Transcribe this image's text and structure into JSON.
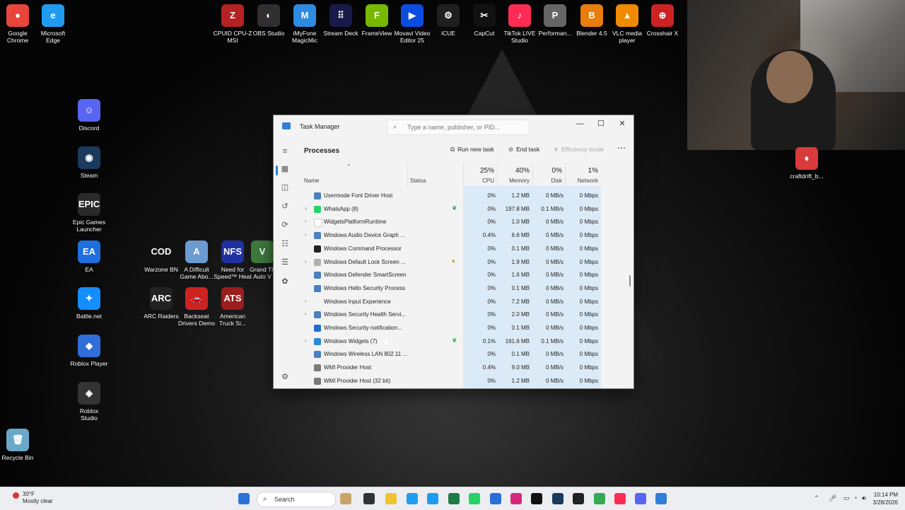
{
  "desktop": {
    "icons_left": [
      {
        "label": "Google\nChrome",
        "glyph": "●",
        "color": "#e8453c"
      },
      {
        "label": "Microsoft\nEdge",
        "glyph": "e",
        "color": "#1f9cf0"
      },
      {
        "label": "Discord",
        "glyph": "☺",
        "color": "#5865f2"
      },
      {
        "label": "Steam",
        "glyph": "◉",
        "color": "#1b3a5c"
      },
      {
        "label": "Epic Games\nLauncher",
        "glyph": "EPIC",
        "color": "#2a2a2a"
      },
      {
        "label": "EA",
        "glyph": "EA",
        "color": "#1f6fe0"
      },
      {
        "label": "Battle.net",
        "glyph": "✦",
        "color": "#148eff"
      },
      {
        "label": "Roblox Player",
        "glyph": "◆",
        "color": "#2f6ed8"
      },
      {
        "label": "Roblox\nStudio",
        "glyph": "◈",
        "color": "#333"
      },
      {
        "label": "Recycle Bin",
        "glyph": "🗑",
        "color": "#6aa8c8"
      }
    ],
    "icons_games": [
      {
        "label": "Warzone BN",
        "glyph": "COD",
        "color": "#111"
      },
      {
        "label": "A Difficult\nGame Abo...",
        "glyph": "A",
        "color": "#6b9bd1"
      },
      {
        "label": "Need for\nSpeed™ Heat",
        "glyph": "NFS",
        "color": "#2030a0"
      },
      {
        "label": "Grand Th\nAuto V",
        "glyph": "V",
        "color": "#3d7a3d"
      },
      {
        "label": "ARC Raiders",
        "glyph": "ARC",
        "color": "#222"
      },
      {
        "label": "Backseat\nDrivers Demo",
        "glyph": "🚗",
        "color": "#c22"
      },
      {
        "label": "American\nTruck Si...",
        "glyph": "ATS",
        "color": "#9b1d1d"
      }
    ],
    "icons_top": [
      {
        "label": "CPUID CPU-Z\nMSI",
        "glyph": "Z",
        "color": "#b42222"
      },
      {
        "label": "OBS Studio",
        "glyph": "◐",
        "color": "#302e31"
      },
      {
        "label": "iMyFone\nMagicMic",
        "glyph": "M",
        "color": "#2d8be0"
      },
      {
        "label": "Stream Deck",
        "glyph": "⠿",
        "color": "#1a1a4a"
      },
      {
        "label": "FrameView",
        "glyph": "F",
        "color": "#76b900"
      },
      {
        "label": "Movavi Video\nEditor 25",
        "glyph": "▶",
        "color": "#0a4de0"
      },
      {
        "label": "iCUE",
        "glyph": "⚙",
        "color": "#1f1f1f"
      },
      {
        "label": "CapCut",
        "glyph": "✂",
        "color": "#111"
      },
      {
        "label": "TikTok LIVE\nStudio",
        "glyph": "♪",
        "color": "#fe2c55"
      },
      {
        "label": "Performan...",
        "glyph": "P",
        "color": "#666"
      },
      {
        "label": "Blender 4.5",
        "glyph": "B",
        "color": "#e87d0d"
      },
      {
        "label": "VLC media\nplayer",
        "glyph": "▲",
        "color": "#f08a00"
      },
      {
        "label": "Crosshair X",
        "glyph": "⊕",
        "color": "#c22"
      }
    ],
    "file_icon": {
      "label": "craftdrift_b...",
      "glyph": "♦",
      "color": "#d93a3a"
    }
  },
  "task_manager": {
    "title": "Task Manager",
    "search_placeholder": "Type a name, publisher, or PID...",
    "heading": "Processes",
    "run_new_task": "Run new task",
    "end_task": "End task",
    "efficiency_mode": "Efficiency mode",
    "more": "⋯",
    "columns": {
      "name": "Name",
      "status": "Status",
      "cpu_pct": "25%",
      "cpu": "CPU",
      "mem_pct": "40%",
      "mem": "Memory",
      "disk_pct": "0%",
      "disk": "Disk",
      "net_pct": "1%",
      "net": "Network"
    },
    "rows": [
      {
        "expand": false,
        "name": "Usermode Font Driver Host",
        "status": "",
        "cpu": "0%",
        "mem": "1.2 MB",
        "disk": "0 MB/s",
        "net": "0 Mbps",
        "icon_color": "#4a7fc1"
      },
      {
        "expand": true,
        "name": "WhatsApp (8)",
        "status": "leaf",
        "cpu": "0%",
        "mem": "197.8 MB",
        "disk": "0.1 MB/s",
        "net": "0 Mbps",
        "icon_color": "#25d366"
      },
      {
        "expand": true,
        "name": "WidgetsPlatformRuntime",
        "status": "",
        "cpu": "0%",
        "mem": "1.0 MB",
        "disk": "0 MB/s",
        "net": "0 Mbps",
        "icon_color": "#ffffff"
      },
      {
        "expand": true,
        "name": "Windows Audio Device Graph ...",
        "status": "",
        "cpu": "0.4%",
        "mem": "6.6 MB",
        "disk": "0 MB/s",
        "net": "0 Mbps",
        "icon_color": "#4a7fc1"
      },
      {
        "expand": false,
        "name": "Windows Command Processor",
        "status": "",
        "cpu": "0%",
        "mem": "0.1 MB",
        "disk": "0 MB/s",
        "net": "0 Mbps",
        "icon_color": "#222222"
      },
      {
        "expand": true,
        "name": "Windows Default Lock Screen ...",
        "status": "pause",
        "cpu": "0%",
        "mem": "1.9 MB",
        "disk": "0 MB/s",
        "net": "0 Mbps",
        "icon_color": "#b0b0b0"
      },
      {
        "expand": false,
        "name": "Windows Defender SmartScreen",
        "status": "",
        "cpu": "0%",
        "mem": "1.6 MB",
        "disk": "0 MB/s",
        "net": "0 Mbps",
        "icon_color": "#4a7fc1"
      },
      {
        "expand": false,
        "name": "Windows Hello Security Process",
        "status": "",
        "cpu": "0%",
        "mem": "0.1 MB",
        "disk": "0 MB/s",
        "net": "0 Mbps",
        "icon_color": "#4a7fc1"
      },
      {
        "expand": true,
        "name": "Windows Input Experience",
        "status": "",
        "cpu": "0%",
        "mem": "7.2 MB",
        "disk": "0 MB/s",
        "net": "0 Mbps",
        "icon_color": ""
      },
      {
        "expand": true,
        "name": "Windows Security Health Servi...",
        "status": "",
        "cpu": "0%",
        "mem": "2.0 MB",
        "disk": "0 MB/s",
        "net": "0 Mbps",
        "icon_color": "#4a7fc1"
      },
      {
        "expand": false,
        "name": "Windows Security notification...",
        "status": "",
        "cpu": "0%",
        "mem": "0.1 MB",
        "disk": "0 MB/s",
        "net": "0 Mbps",
        "icon_color": "#1e6fd0"
      },
      {
        "expand": true,
        "name": "Windows Widgets (7)",
        "status": "leaf",
        "cpu": "0.1%",
        "mem": "161.6 MB",
        "disk": "0.1 MB/s",
        "net": "0 Mbps",
        "icon_color": "#2b8ad8"
      },
      {
        "expand": false,
        "name": "Windows Wireless LAN 802.11 ...",
        "status": "",
        "cpu": "0%",
        "mem": "0.1 MB",
        "disk": "0 MB/s",
        "net": "0 Mbps",
        "icon_color": "#4a7fc1"
      },
      {
        "expand": false,
        "name": "WMI Provider Host",
        "status": "",
        "cpu": "0.4%",
        "mem": "9.0 MB",
        "disk": "0 MB/s",
        "net": "0 Mbps",
        "icon_color": "#7a7a7a"
      },
      {
        "expand": false,
        "name": "WMI Provider Host (32 bit)",
        "status": "",
        "cpu": "0%",
        "mem": "1.2 MB",
        "disk": "0 MB/s",
        "net": "0 Mbps",
        "icon_color": "#7a7a7a"
      }
    ]
  },
  "taskbar": {
    "weather_temp": "30°F",
    "weather_desc": "Mostly clear",
    "search_label": "Search",
    "time": "10:14 PM",
    "date": "3/28/2026",
    "apps": [
      {
        "name": "badger-app",
        "color": "#c9a46a"
      },
      {
        "name": "task-view",
        "color": "#333"
      },
      {
        "name": "file-explorer",
        "color": "#f1c232"
      },
      {
        "name": "edge",
        "color": "#1f9cf0"
      },
      {
        "name": "twitter-app",
        "color": "#1d9bf0"
      },
      {
        "name": "excel-app",
        "color": "#1f7a44"
      },
      {
        "name": "whatsapp-app",
        "color": "#25d366"
      },
      {
        "name": "store-app",
        "color": "#2a6ed8"
      },
      {
        "name": "instagram-app",
        "color": "#d6287a"
      },
      {
        "name": "tiktok-app",
        "color": "#111"
      },
      {
        "name": "steam-app",
        "color": "#1b3a5c"
      },
      {
        "name": "xbox-app",
        "color": "#222"
      },
      {
        "name": "chrome-app",
        "color": "#34a853"
      },
      {
        "name": "tiktok-live-app",
        "color": "#fe2c55"
      },
      {
        "name": "discord-app",
        "color": "#5865f2"
      },
      {
        "name": "task-manager-app",
        "color": "#2f7fd6"
      }
    ]
  }
}
